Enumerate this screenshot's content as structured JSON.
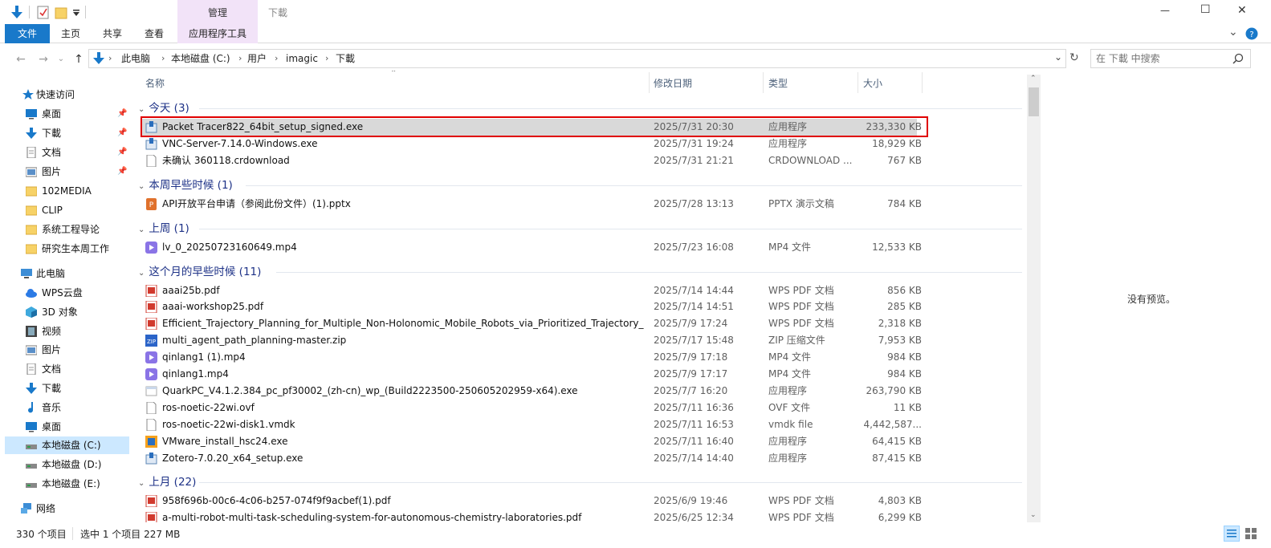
{
  "titlebar": {
    "context_tab": "管理",
    "window_title": "下載",
    "controls": {
      "minimize": "—",
      "maximize": "☐",
      "close": "✕"
    }
  },
  "ribbon": {
    "tabs": [
      "文件",
      "主页",
      "共享",
      "查看",
      "应用程序工具"
    ],
    "expand_glyph": "⌄"
  },
  "address": {
    "crumbs": [
      "此电脑",
      "本地磁盘 (C:)",
      "用户",
      "imagic",
      "下載"
    ],
    "search_placeholder": "在 下載 中搜索"
  },
  "nav": {
    "quick_access": "快速访问",
    "pinned": [
      "桌面",
      "下載",
      "文档",
      "图片"
    ],
    "folders": [
      "102MEDIA",
      "CLIP",
      "系统工程导论",
      "研究生本周工作"
    ],
    "this_pc": "此电脑",
    "pc_items": [
      "WPS云盘",
      "3D 对象",
      "视频",
      "图片",
      "文档",
      "下載",
      "音乐",
      "桌面",
      "本地磁盘 (C:)",
      "本地磁盘 (D:)",
      "本地磁盘 (E:)"
    ],
    "network": "网络"
  },
  "columns": {
    "name": "名称",
    "date": "修改日期",
    "type": "类型",
    "size": "大小"
  },
  "groups": [
    {
      "title": "今天 (3)",
      "files": [
        {
          "name": "Packet Tracer822_64bit_setup_signed.exe",
          "date": "2025/7/31 20:30",
          "type": "应用程序",
          "size": "233,330 KB",
          "icon": "installer-icon"
        },
        {
          "name": "VNC-Server-7.14.0-Windows.exe",
          "date": "2025/7/31 19:24",
          "type": "应用程序",
          "size": "18,929 KB",
          "icon": "installer-icon"
        },
        {
          "name": "未确认 360118.crdownload",
          "date": "2025/7/31 21:21",
          "type": "CRDOWNLOAD ...",
          "size": "767 KB",
          "icon": "blank-file-icon"
        }
      ]
    },
    {
      "title": "本周早些时候 (1)",
      "files": [
        {
          "name": "API开放平台申请（参阅此份文件）(1).pptx",
          "date": "2025/7/28 13:13",
          "type": "PPTX 演示文稿",
          "size": "784 KB",
          "icon": "pptx-icon"
        }
      ]
    },
    {
      "title": "上周 (1)",
      "files": [
        {
          "name": "lv_0_20250723160649.mp4",
          "date": "2025/7/23 16:08",
          "type": "MP4 文件",
          "size": "12,533 KB",
          "icon": "video-icon"
        }
      ]
    },
    {
      "title": "这个月的早些时候 (11)",
      "files": [
        {
          "name": "aaai25b.pdf",
          "date": "2025/7/14 14:44",
          "type": "WPS PDF 文档",
          "size": "856 KB",
          "icon": "pdf-icon"
        },
        {
          "name": "aaai-workshop25.pdf",
          "date": "2025/7/14 14:51",
          "type": "WPS PDF 文档",
          "size": "285 KB",
          "icon": "pdf-icon"
        },
        {
          "name": "Efficient_Trajectory_Planning_for_Multiple_Non-Holonomic_Mobile_Robots_via_Prioritized_Trajectory_O...",
          "date": "2025/7/9 17:24",
          "type": "WPS PDF 文档",
          "size": "2,318 KB",
          "icon": "pdf-icon"
        },
        {
          "name": "multi_agent_path_planning-master.zip",
          "date": "2025/7/17 15:48",
          "type": "ZIP 压缩文件",
          "size": "7,953 KB",
          "icon": "zip-icon"
        },
        {
          "name": "qinlang1 (1).mp4",
          "date": "2025/7/9 17:18",
          "type": "MP4 文件",
          "size": "984 KB",
          "icon": "video-icon"
        },
        {
          "name": "qinlang1.mp4",
          "date": "2025/7/9 17:17",
          "type": "MP4 文件",
          "size": "984 KB",
          "icon": "video-icon"
        },
        {
          "name": "QuarkPC_V4.1.2.384_pc_pf30002_(zh-cn)_wp_(Build2223500-250605202959-x64).exe",
          "date": "2025/7/7 16:20",
          "type": "应用程序",
          "size": "263,790 KB",
          "icon": "app-icon"
        },
        {
          "name": "ros-noetic-22wi.ovf",
          "date": "2025/7/11 16:36",
          "type": "OVF 文件",
          "size": "11 KB",
          "icon": "blank-file-icon"
        },
        {
          "name": "ros-noetic-22wi-disk1.vmdk",
          "date": "2025/7/11 16:53",
          "type": "vmdk file",
          "size": "4,442,587...",
          "icon": "blank-file-icon"
        },
        {
          "name": "VMware_install_hsc24.exe",
          "date": "2025/7/11 16:40",
          "type": "应用程序",
          "size": "64,415 KB",
          "icon": "vmware-icon"
        },
        {
          "name": "Zotero-7.0.20_x64_setup.exe",
          "date": "2025/7/14 14:40",
          "type": "应用程序",
          "size": "87,415 KB",
          "icon": "installer-icon"
        }
      ]
    },
    {
      "title": "上月 (22)",
      "files": [
        {
          "name": "958f696b-00c6-4c06-b257-074f9f9acbef(1).pdf",
          "date": "2025/6/9 19:46",
          "type": "WPS PDF 文档",
          "size": "4,803 KB",
          "icon": "pdf-icon"
        },
        {
          "name": "a-multi-robot-multi-task-scheduling-system-for-autonomous-chemistry-laboratories.pdf",
          "date": "2025/6/25 12:34",
          "type": "WPS PDF 文档",
          "size": "6,299 KB",
          "icon": "pdf-icon"
        }
      ]
    }
  ],
  "preview": {
    "empty_text": "没有预览。"
  },
  "status": {
    "count": "330 个项目",
    "selection": "选中 1 个项目  227 MB"
  },
  "colors": {
    "accent": "#1979ca",
    "group_text": "#1e3287",
    "selection": "#d9d9d9",
    "highlight_box": "#e00000",
    "context_tab_bg": "#f2e3f8"
  }
}
